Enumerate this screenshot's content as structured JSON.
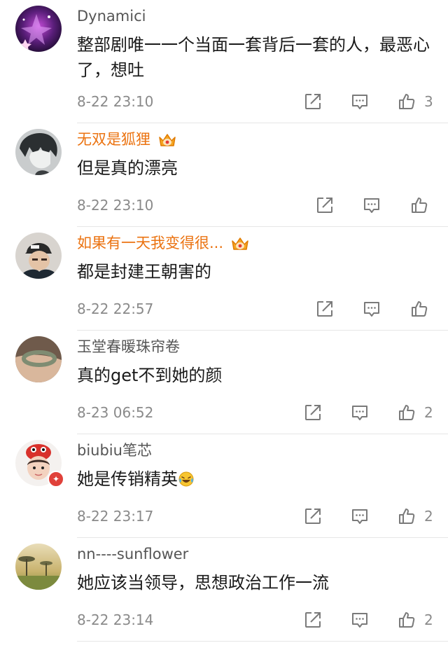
{
  "comments": [
    {
      "username": "Dynamici",
      "vip": false,
      "text": "整部剧唯一一个当面一套背后一套的人，最恶心了，想吐",
      "time": "8-22 23:10",
      "likes": "3",
      "avatar": "starry-purple-icon"
    },
    {
      "username": "无双是狐狸",
      "vip": true,
      "text": "但是真的漂亮",
      "time": "8-22 23:10",
      "likes": "",
      "avatar": "anime-boy-icon"
    },
    {
      "username": "如果有一天我变得很...",
      "vip": true,
      "text": "都是封建王朝害的",
      "time": "8-22 22:57",
      "likes": "",
      "avatar": "cap-man-icon"
    },
    {
      "username": "玉堂春暖珠帘卷",
      "vip": false,
      "text": "真的get不到她的颜",
      "time": "8-23 06:52",
      "likes": "2",
      "avatar": "bracelet-icon"
    },
    {
      "username": "biubiu笔芯",
      "vip": false,
      "text": "她是传销精英",
      "time": "8-22 23:17",
      "likes": "2",
      "avatar": "baby-icon",
      "emoji": "laugh-cry-emoji"
    },
    {
      "username": "nn----sunflower",
      "vip": false,
      "text": "她应该当领导，思想政治工作一流",
      "time": "8-22 23:14",
      "likes": "2",
      "avatar": "tree-landscape-icon"
    }
  ],
  "colors": {
    "vip_name": "#eb7311",
    "name": "#555555",
    "meta": "#8a8a8a",
    "divider": "#e6e6e6",
    "icon": "#7a7a7a"
  }
}
